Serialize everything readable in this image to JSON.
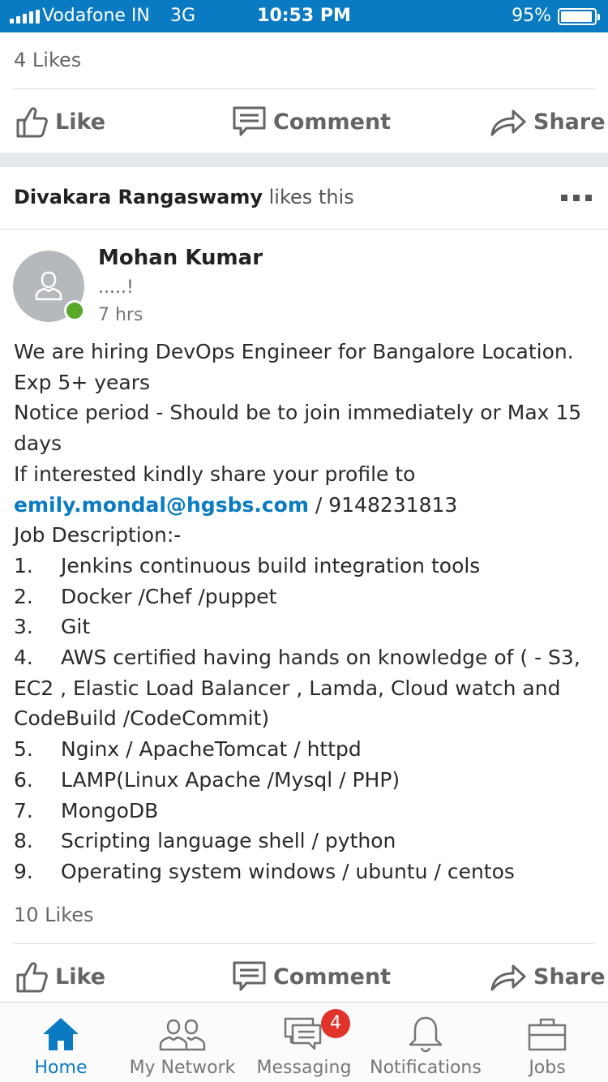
{
  "status_bar": {
    "carrier": "Vodafone IN",
    "network": "3G",
    "time": "10:53 PM",
    "battery_percent": "95%",
    "battery_level": 0.95,
    "background_color": "#0a7bc2"
  },
  "previous_post": {
    "likes": "4 Likes",
    "actions": {
      "like": "Like",
      "comment": "Comment",
      "share": "Share"
    }
  },
  "post": {
    "social_actor": "Divakara Rangaswamy",
    "social_action": "likes this",
    "author": "Mohan Kumar",
    "headline": ".....!",
    "time_ago": "7 hrs",
    "online": true,
    "body": {
      "line1": "We are hiring DevOps Engineer for Bangalore Location.",
      "line2": "Exp 5+ years",
      "line3": "Notice period - Should be to join immediately or Max 15",
      "line4": "days",
      "line5": "If interested kindly share your profile to",
      "email": "emily.mondal@hgsbs.com",
      "phone": " / 9148231813",
      "jd_title": "Job Description:-",
      "items": [
        {
          "num": "1.",
          "text": "Jenkins continuous build integration tools"
        },
        {
          "num": "2.",
          "text": "Docker /Chef /puppet"
        },
        {
          "num": "3.",
          "text": "Git"
        },
        {
          "num": "4.",
          "text": "AWS certified having hands on knowledge of ( - S3,"
        },
        {
          "num": "5.",
          "text": "Nginx / ApacheTomcat / httpd"
        },
        {
          "num": "6.",
          "text": "LAMP(Linux Apache /Mysql / PHP)"
        },
        {
          "num": "7.",
          "text": "MongoDB"
        },
        {
          "num": "8.",
          "text": "Scripting language shell / python"
        },
        {
          "num": "9.",
          "text": "Operating system windows / ubuntu / centos"
        }
      ],
      "item4_cont1": "EC2 , Elastic Load Balancer , Lamda, Cloud watch and",
      "item4_cont2": "CodeBuild /CodeCommit)"
    },
    "likes": "10 Likes",
    "actions": {
      "like": "Like",
      "comment": "Comment",
      "share": "Share"
    }
  },
  "tabbar": {
    "home": "Home",
    "my_network": "My Network",
    "messaging": "Messaging",
    "messaging_badge": "4",
    "notifications": "Notifications",
    "jobs": "Jobs",
    "active_color": "#0a7bc2"
  }
}
